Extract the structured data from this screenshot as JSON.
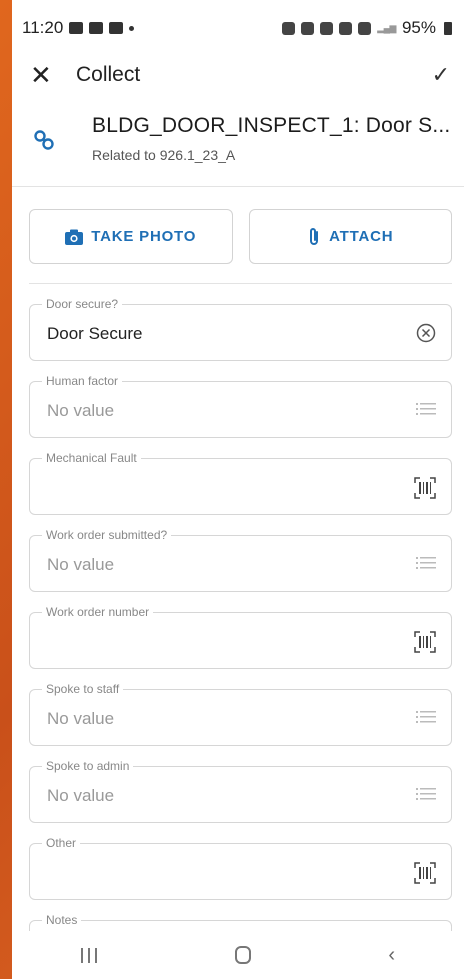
{
  "status_bar": {
    "time": "11:20",
    "battery": "95%"
  },
  "app_bar": {
    "close_icon": "close-icon",
    "title": "Collect",
    "confirm_icon": "check-icon"
  },
  "header": {
    "icon": "link-icon",
    "title": "BLDG_DOOR_INSPECT_1: Door S...",
    "subtitle": "Related to 926.1_23_A"
  },
  "actions": {
    "take_photo_label": "TAKE PHOTO",
    "attach_label": "ATTACH"
  },
  "fields": [
    {
      "label": "Door secure?",
      "value": "Door Secure",
      "empty": false,
      "icon": "clear-icon"
    },
    {
      "label": "Human factor",
      "value": "No value",
      "empty": true,
      "icon": "list-icon"
    },
    {
      "label": "Mechanical Fault",
      "value": "",
      "empty": true,
      "icon": "barcode-icon"
    },
    {
      "label": "Work order submitted?",
      "value": "No value",
      "empty": true,
      "icon": "list-icon"
    },
    {
      "label": "Work order number",
      "value": "",
      "empty": true,
      "icon": "barcode-icon"
    },
    {
      "label": "Spoke to staff",
      "value": "No value",
      "empty": true,
      "icon": "list-icon"
    },
    {
      "label": "Spoke to admin",
      "value": "No value",
      "empty": true,
      "icon": "list-icon"
    },
    {
      "label": "Other",
      "value": "",
      "empty": true,
      "icon": "barcode-icon"
    },
    {
      "label": "Notes",
      "value": "",
      "empty": true,
      "icon": ""
    }
  ],
  "colors": {
    "accent": "#1f6fb5",
    "frame": "#d9591a"
  }
}
